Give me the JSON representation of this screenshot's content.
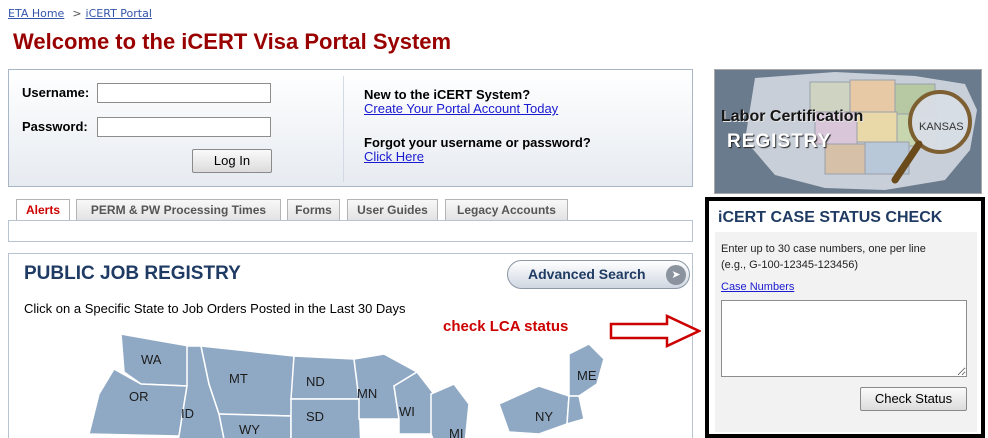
{
  "breadcrumb": {
    "home": "ETA Home",
    "separator": ">",
    "current": "iCERT Portal"
  },
  "page": {
    "title": "Welcome to the iCERT Visa Portal System"
  },
  "login": {
    "username_label": "Username:",
    "password_label": "Password:",
    "username_value": "",
    "password_value": "",
    "login_button": "Log In",
    "new_user_question": "New to the iCERT System?",
    "create_account_link": "Create Your Portal Account Today",
    "forgot_question": "Forgot your username or password?",
    "click_here_link": "Click Here"
  },
  "tabs": [
    {
      "label": "Alerts",
      "active": true
    },
    {
      "label": "PERM & PW Processing Times",
      "active": false
    },
    {
      "label": "Forms",
      "active": false
    },
    {
      "label": "User Guides",
      "active": false
    },
    {
      "label": "Legacy Accounts",
      "active": false
    }
  ],
  "job_registry": {
    "title": "PUBLIC JOB REGISTRY",
    "advanced_search": "Advanced Search",
    "subtitle": "Click on a Specific State to Job Orders Posted in the Last 30 Days",
    "states": [
      "WA",
      "OR",
      "MT",
      "ID",
      "WY",
      "ND",
      "SD",
      "MN",
      "WI",
      "MI",
      "NY",
      "ME"
    ]
  },
  "annotation": {
    "text": "check LCA status",
    "color": "#cc0000"
  },
  "banner": {
    "line1": "Labor Certification",
    "line2": "REGISTRY",
    "map_label": "KANSAS"
  },
  "case_status": {
    "title": "iCERT CASE STATUS CHECK",
    "instruction_line1": "Enter up to 30 case numbers, one per line",
    "instruction_line2": "(e.g., G-100-12345-123456)",
    "field_label": "Case Numbers",
    "textarea_value": "",
    "button": "Check Status"
  },
  "colors": {
    "title_red": "#990000",
    "heading_navy": "#1f3b63",
    "link_blue": "#1a1ad0",
    "map_fill": "#8fa9c5"
  }
}
